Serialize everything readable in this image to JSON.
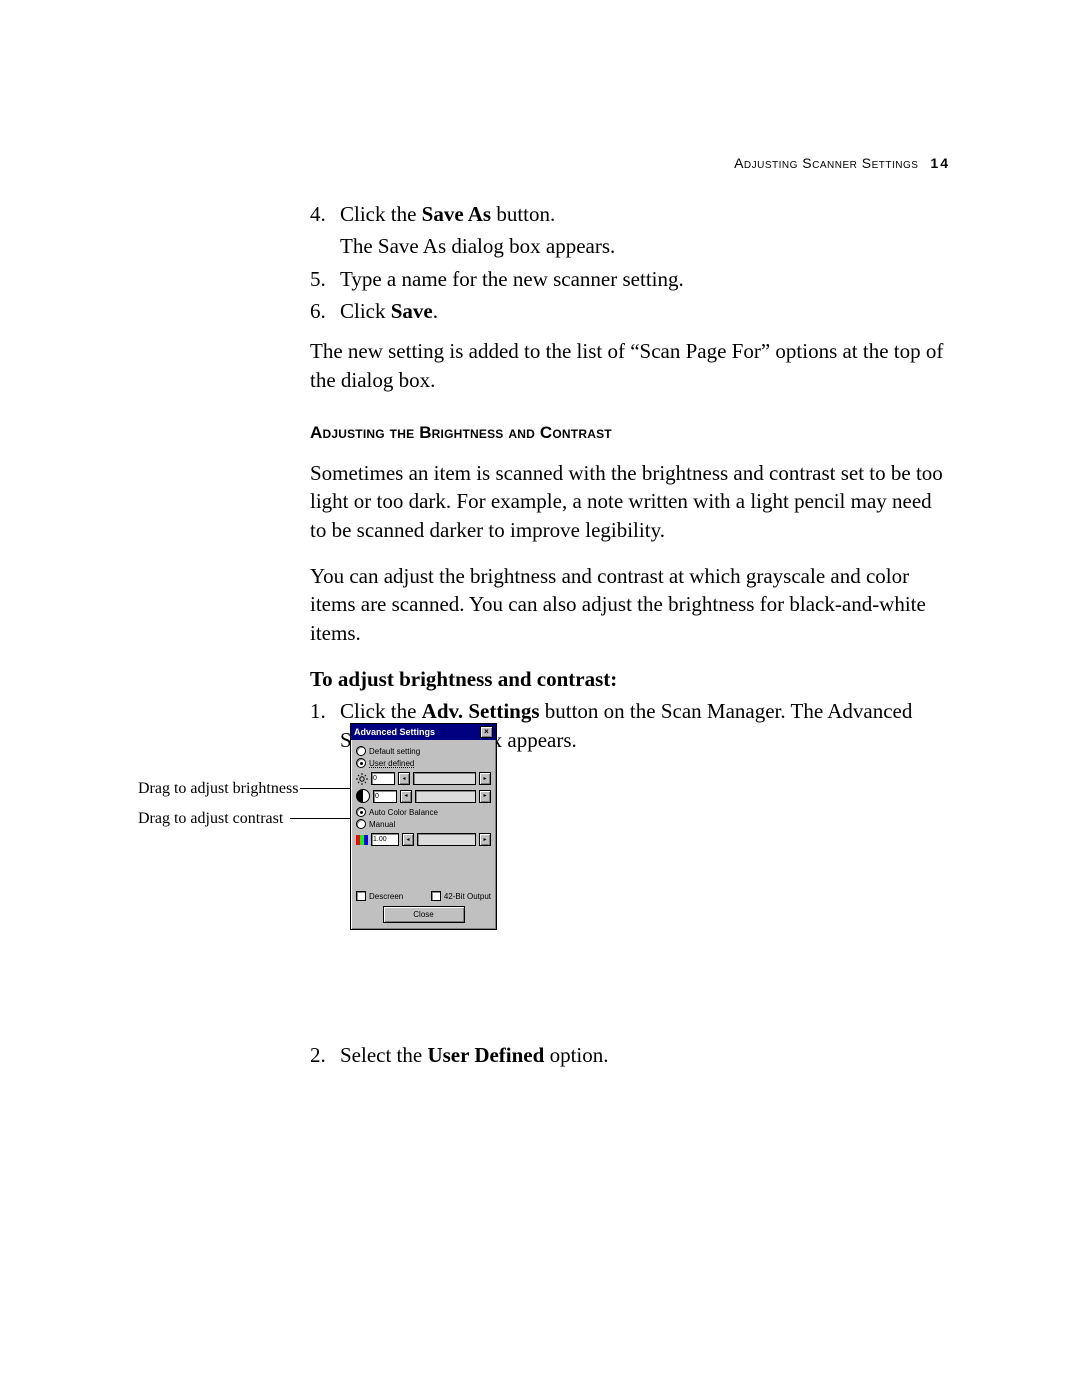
{
  "header": {
    "title": "Adjusting Scanner Settings",
    "page_number": "14"
  },
  "steps_a": [
    {
      "n": "4.",
      "pre": "Click the ",
      "bold": "Save As",
      "post": " button."
    },
    {
      "n": "",
      "plain": "The Save As dialog box appears."
    },
    {
      "n": "5.",
      "plain": "Type a name for the new scanner setting."
    },
    {
      "n": "6.",
      "pre": "Click ",
      "bold": "Save",
      "post": "."
    }
  ],
  "para_after_steps_a": "The new setting is added to the list of “Scan Page For” options at the top of the dialog box.",
  "section_heading": "Adjusting the Brightness and Contrast",
  "para_b1": "Sometimes an item is scanned with the brightness and contrast set to be too light or too dark. For example, a note written with a light pencil may need to be scanned darker to improve legibility.",
  "para_b2": "You can adjust the brightness and contrast at which grayscale and color items are scanned. You can also adjust the brightness for black-and-white items.",
  "subhead_bold": "To adjust brightness and contrast:",
  "steps_b": [
    {
      "n": "1.",
      "pre": "Click the ",
      "bold": "Adv. Settings",
      "post": " button on the Scan Manager. The Advanced Settings dialog box appears."
    }
  ],
  "step_b2": {
    "n": "2.",
    "pre": "Select the ",
    "bold": "User Defined",
    "post": " option."
  },
  "callouts": {
    "brightness": "Drag to adjust brightness",
    "contrast": "Drag to adjust contrast"
  },
  "dialog": {
    "title": "Advanced Settings",
    "close": "×",
    "radio_default": "Default setting",
    "radio_user": "User defined",
    "brightness_value": "0",
    "contrast_value": "0",
    "radio_auto": "Auto Color Balance",
    "radio_manual": "Manual",
    "color_value": "1.00",
    "chk_descreen": "Descreen",
    "chk_42bit": "42-Bit Output",
    "close_btn": "Close",
    "arrow_left": "◂",
    "arrow_right": "▸"
  }
}
